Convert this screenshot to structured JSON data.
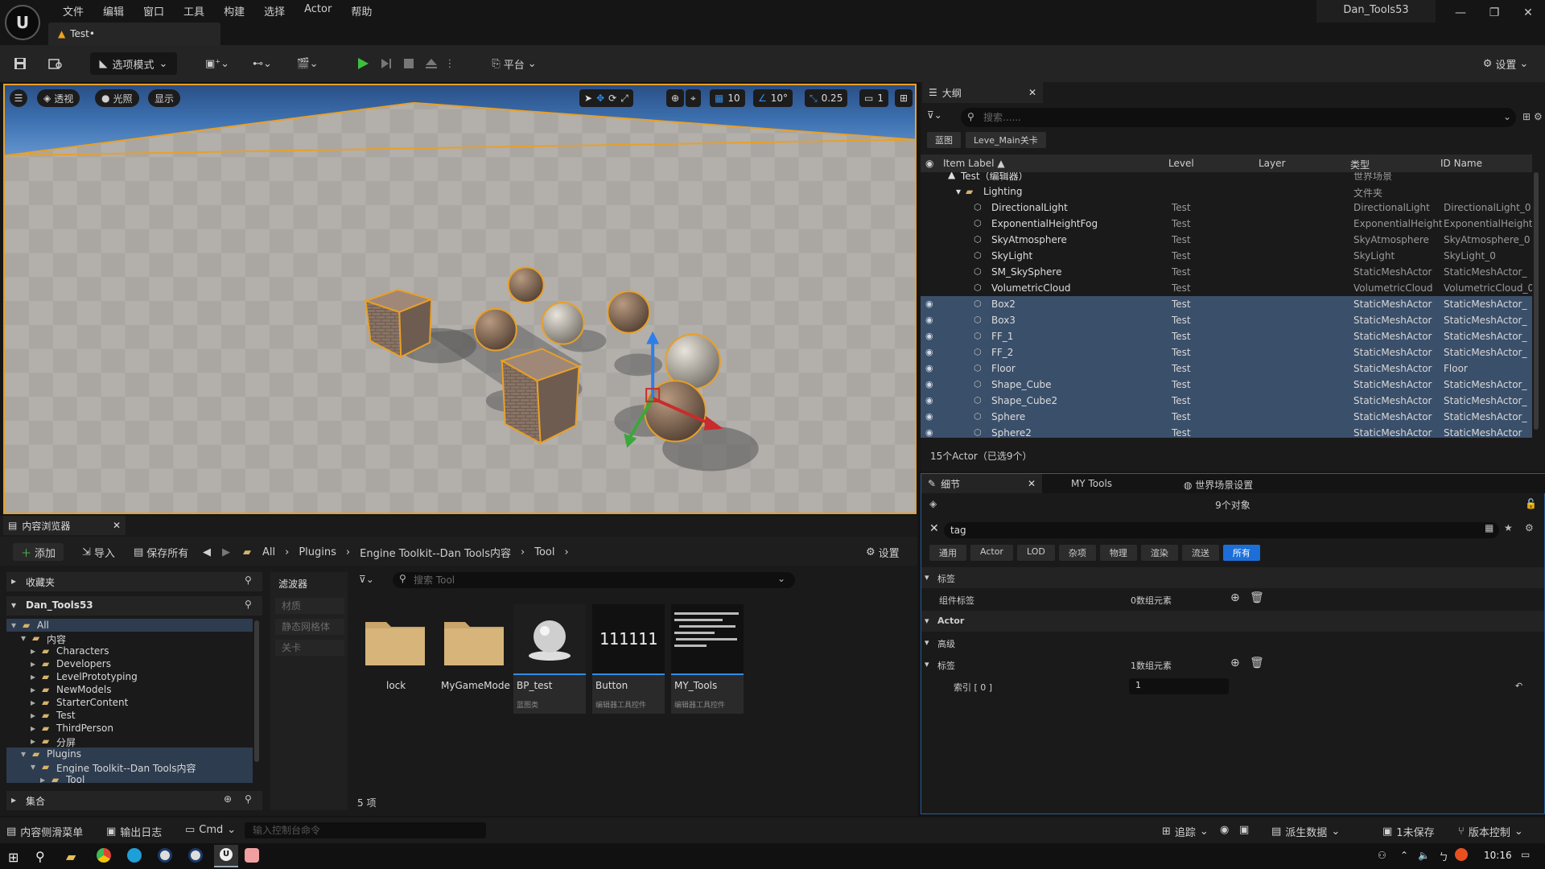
{
  "menu": [
    "文件",
    "编辑",
    "窗口",
    "工具",
    "构建",
    "选择",
    "Actor",
    "帮助"
  ],
  "project_name": "Dan_Tools53",
  "doc_tab": "Test•",
  "toolbar": {
    "mode_label": "选项模式",
    "platform_label": "平台",
    "settings_label": "设置"
  },
  "viewport": {
    "perspective": "透视",
    "lighting": "光照",
    "show": "显示",
    "grid_snap": "10",
    "rot_snap": "10°",
    "scale_snap": "0.25",
    "camera_speed": "1"
  },
  "outliner": {
    "tab": "大纲",
    "search_placeholder": "搜索......",
    "tags": [
      "蓝图",
      "Leve_Main关卡"
    ],
    "columns": {
      "label": "Item Label ▲",
      "level": "Level",
      "layer": "Layer",
      "type": "类型",
      "id": "ID Name"
    },
    "world_row": {
      "label": "Test（编辑器）",
      "type": "世界场景"
    },
    "folder": {
      "label": "Lighting",
      "type": "文件夹"
    },
    "rows": [
      {
        "label": "DirectionalLight",
        "level": "Test",
        "type": "DirectionalLight",
        "id": "DirectionalLight_0",
        "sel": false
      },
      {
        "label": "ExponentialHeightFog",
        "level": "Test",
        "type": "ExponentialHeightF",
        "id": "ExponentialHeight",
        "sel": false
      },
      {
        "label": "SkyAtmosphere",
        "level": "Test",
        "type": "SkyAtmosphere",
        "id": "SkyAtmosphere_0",
        "sel": false
      },
      {
        "label": "SkyLight",
        "level": "Test",
        "type": "SkyLight",
        "id": "SkyLight_0",
        "sel": false
      },
      {
        "label": "SM_SkySphere",
        "level": "Test",
        "type": "StaticMeshActor",
        "id": "StaticMeshActor_",
        "sel": false
      },
      {
        "label": "VolumetricCloud",
        "level": "Test",
        "type": "VolumetricCloud",
        "id": "VolumetricCloud_0",
        "sel": false
      },
      {
        "label": "Box2",
        "level": "Test",
        "type": "StaticMeshActor",
        "id": "StaticMeshActor_",
        "sel": true
      },
      {
        "label": "Box3",
        "level": "Test",
        "type": "StaticMeshActor",
        "id": "StaticMeshActor_",
        "sel": true
      },
      {
        "label": "FF_1",
        "level": "Test",
        "type": "StaticMeshActor",
        "id": "StaticMeshActor_",
        "sel": true
      },
      {
        "label": "FF_2",
        "level": "Test",
        "type": "StaticMeshActor",
        "id": "StaticMeshActor_",
        "sel": true
      },
      {
        "label": "Floor",
        "level": "Test",
        "type": "StaticMeshActor",
        "id": "Floor",
        "sel": true
      },
      {
        "label": "Shape_Cube",
        "level": "Test",
        "type": "StaticMeshActor",
        "id": "StaticMeshActor_",
        "sel": true
      },
      {
        "label": "Shape_Cube2",
        "level": "Test",
        "type": "StaticMeshActor",
        "id": "StaticMeshActor_",
        "sel": true
      },
      {
        "label": "Sphere",
        "level": "Test",
        "type": "StaticMeshActor",
        "id": "StaticMeshActor_",
        "sel": true
      },
      {
        "label": "Sphere2",
        "level": "Test",
        "type": "StaticMeshActor",
        "id": "StaticMeshActor_",
        "sel": true
      }
    ],
    "status": "15个Actor（已选9个）"
  },
  "details": {
    "tabs": [
      "细节",
      "MY Tools",
      "世界场景设置"
    ],
    "count": "9个对象",
    "search_value": "tag",
    "filters": [
      "通用",
      "Actor",
      "LOD",
      "杂项",
      "物理",
      "渲染",
      "流送",
      "所有"
    ],
    "rows": [
      {
        "label": "标签",
        "value": ""
      },
      {
        "label": "组件标签",
        "value": "0数组元素"
      },
      {
        "label": "Actor",
        "value": ""
      },
      {
        "label": "高级",
        "value": ""
      },
      {
        "label": "标签",
        "value": "1数组元素"
      },
      {
        "label": "索引 [ 0 ]",
        "value": "1"
      }
    ]
  },
  "content_browser": {
    "tab": "内容浏览器",
    "add": "添加",
    "import": "导入",
    "save_all": "保存所有",
    "path": [
      "All",
      "Plugins",
      "Engine Toolkit--Dan Tools内容",
      "Tool"
    ],
    "settings": "设置",
    "favorites": "收藏夹",
    "project": "Dan_Tools53",
    "tree": [
      {
        "label": "All",
        "depth": 0
      },
      {
        "label": "内容",
        "depth": 1
      },
      {
        "label": "Characters",
        "depth": 2
      },
      {
        "label": "Developers",
        "depth": 2
      },
      {
        "label": "LevelPrototyping",
        "depth": 2
      },
      {
        "label": "NewModels",
        "depth": 2
      },
      {
        "label": "StarterContent",
        "depth": 2
      },
      {
        "label": "Test",
        "depth": 2
      },
      {
        "label": "ThirdPerson",
        "depth": 2
      },
      {
        "label": "分屏",
        "depth": 2
      },
      {
        "label": "Plugins",
        "depth": 1
      },
      {
        "label": "Engine Toolkit--Dan Tools内容",
        "depth": 2
      },
      {
        "label": "Tool",
        "depth": 3
      }
    ],
    "collections": "集合",
    "filters_title": "滤波器",
    "filter_items": [
      "材质",
      "静态网格体",
      "关卡"
    ],
    "search_placeholder": "搜索 Tool",
    "assets": [
      {
        "label": "lock",
        "sub": ""
      },
      {
        "label": "MyGameMode",
        "sub": ""
      },
      {
        "label": "BP_test",
        "sub": "蓝图类"
      },
      {
        "label": "Button",
        "sub": "编辑器工具控件"
      },
      {
        "label": "MY_Tools",
        "sub": "编辑器工具控件"
      }
    ],
    "button_thumb_text": "111111",
    "item_count": "5 项"
  },
  "statusbar": {
    "drawer": "内容侧滑菜单",
    "output_log": "输出日志",
    "cmd": "Cmd",
    "console_placeholder": "输入控制台命令",
    "trace": "追踪",
    "derived": "派生数据",
    "unsaved": "1未保存",
    "source_control": "版本控制"
  },
  "taskbar": {
    "time": "10:16"
  },
  "colors": {
    "accent": "#1c6fd8",
    "selection": "#e8a028",
    "selected_row": "#3a4f6a"
  }
}
